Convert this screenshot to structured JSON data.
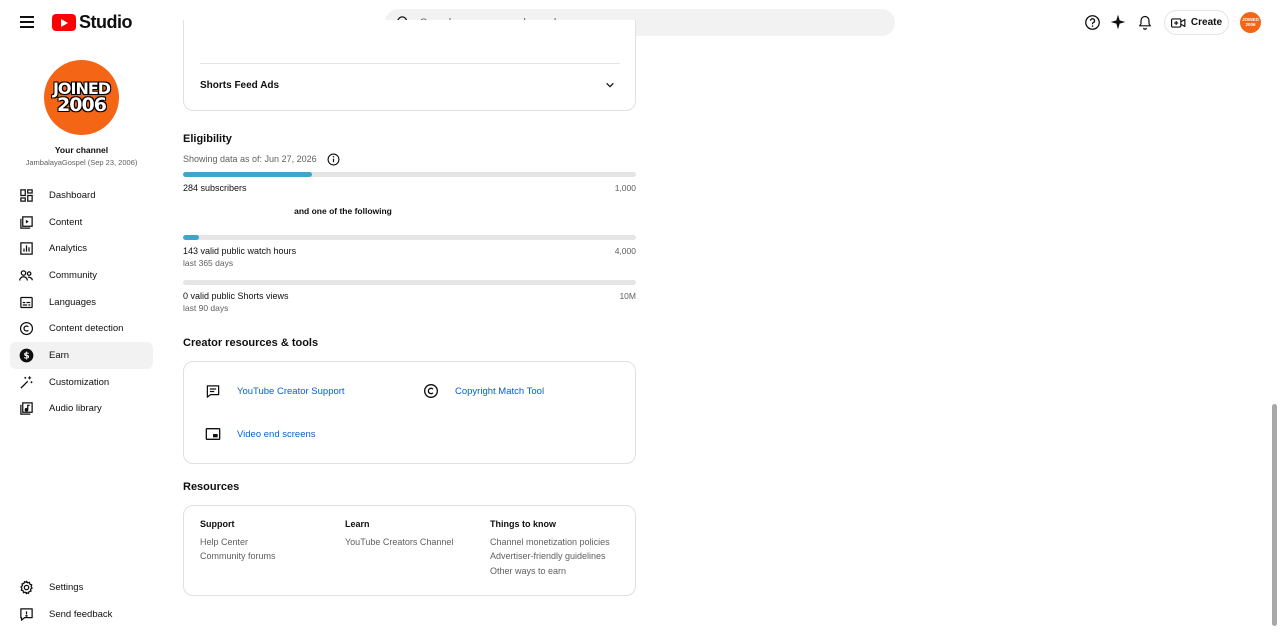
{
  "header": {
    "app_name": "Studio",
    "search_placeholder": "Search across your channel",
    "create_label": "Create",
    "avatar_text_line1": "JOINED",
    "avatar_text_line2": "2006"
  },
  "sidebar": {
    "avatar_line1": "JOINED",
    "avatar_line2": "2006",
    "your_channel": "Your channel",
    "channel_name": "JambalayaGospel (Sep 23, 2006)",
    "items": [
      {
        "label": "Dashboard",
        "icon": "dashboard-icon"
      },
      {
        "label": "Content",
        "icon": "content-icon"
      },
      {
        "label": "Analytics",
        "icon": "analytics-icon"
      },
      {
        "label": "Community",
        "icon": "community-icon"
      },
      {
        "label": "Languages",
        "icon": "languages-icon"
      },
      {
        "label": "Content detection",
        "icon": "copyright-icon"
      },
      {
        "label": "Earn",
        "icon": "dollar-icon",
        "active": true
      },
      {
        "label": "Customization",
        "icon": "magic-wand-icon"
      },
      {
        "label": "Audio library",
        "icon": "audio-library-icon"
      }
    ],
    "bottom_items": [
      {
        "label": "Settings",
        "icon": "gear-icon"
      },
      {
        "label": "Send feedback",
        "icon": "feedback-icon"
      }
    ]
  },
  "ads_card": {
    "row_label": "Shorts Feed Ads"
  },
  "eligibility": {
    "title": "Eligibility",
    "showing_data": "Showing data as of: Jun 27, 2026",
    "subscribers": {
      "label": "284 subscribers",
      "target": "1,000",
      "progress": 0.284
    },
    "and_one": "and one of the following",
    "watch_hours": {
      "label": "143 valid public watch hours",
      "sub": "last 365 days",
      "target": "4,000",
      "progress": 0.0358
    },
    "shorts_views": {
      "label": "0 valid public Shorts views",
      "sub": "last 90 days",
      "target": "10M",
      "progress": 0
    }
  },
  "creator_resources": {
    "title": "Creator resources & tools",
    "links": [
      {
        "label": "YouTube Creator Support",
        "icon": "chat-icon"
      },
      {
        "label": "Copyright Match Tool",
        "icon": "copyright-icon"
      },
      {
        "label": "Video end screens",
        "icon": "end-screen-icon"
      }
    ]
  },
  "resources": {
    "title": "Resources",
    "columns": [
      {
        "heading": "Support",
        "links": [
          "Help Center",
          "Community forums"
        ]
      },
      {
        "heading": "Learn",
        "links": [
          "YouTube Creators Channel"
        ]
      },
      {
        "heading": "Things to know",
        "links": [
          "Channel monetization policies",
          "Advertiser-friendly guidelines",
          "Other ways to earn"
        ]
      }
    ]
  },
  "colors": {
    "brand_red": "#ff0000",
    "avatar_orange": "#f46515",
    "progress_fill": "#3ea6c8",
    "link_blue": "#065fd4"
  }
}
